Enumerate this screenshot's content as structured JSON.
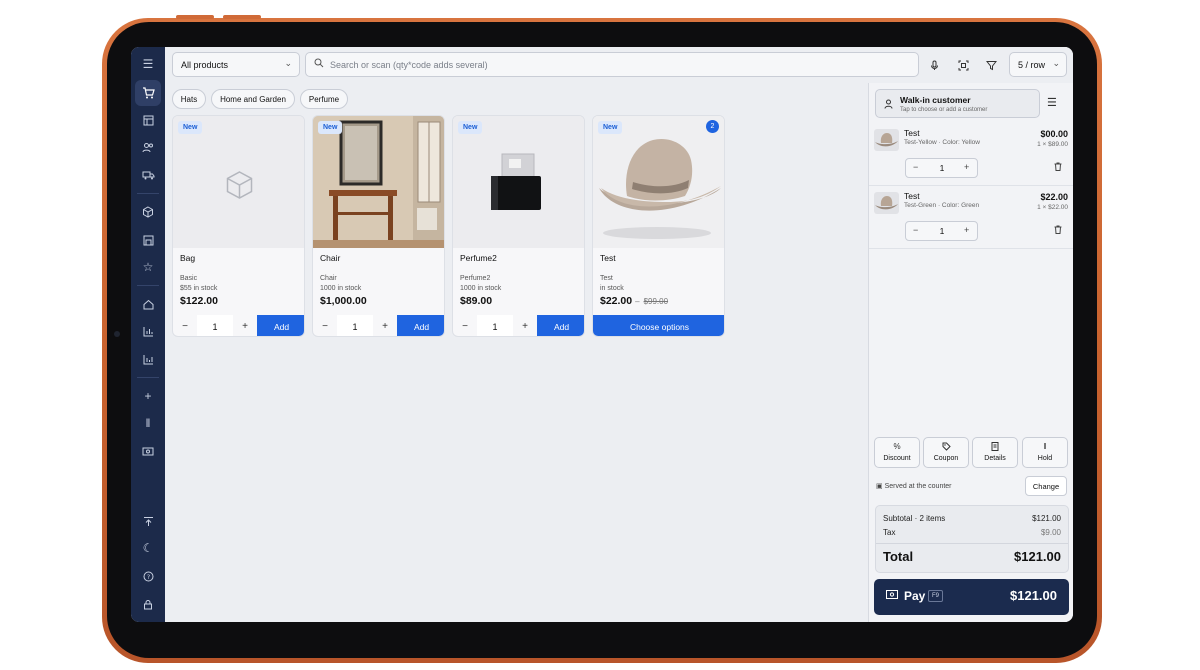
{
  "toolbar": {
    "category_select": "All products",
    "search_placeholder": "Search or scan (qty*code adds several)",
    "per_row": "5 / row"
  },
  "categories": [
    "Hats",
    "Home and Garden",
    "Perfume"
  ],
  "products": [
    {
      "badge": "New",
      "name": "Bag",
      "sku": "Basic",
      "stock": "$55 in stock",
      "price": "$122.00",
      "qty": "1",
      "add_label": "Add"
    },
    {
      "badge": "New",
      "name": "Chair",
      "sku": "Chair",
      "stock": "1000 in stock",
      "price": "$1,000.00",
      "qty": "1",
      "add_label": "Add"
    },
    {
      "badge": "New",
      "name": "Perfume2",
      "sku": "Perfume2",
      "stock": "1000 in stock",
      "price": "$89.00",
      "qty": "1",
      "add_label": "Add"
    },
    {
      "badge": "New",
      "count": "2",
      "name": "Test",
      "sku": "Test",
      "stock": "in stock",
      "price": "$22.00",
      "dash": "–",
      "old_price": "$99.00",
      "options_label": "Choose options"
    }
  ],
  "customer": {
    "title": "Walk-in customer",
    "subtitle": "Tap to choose or add a customer"
  },
  "cart": [
    {
      "name": "Test",
      "variant": "Test-Yellow · Color: Yellow",
      "total": "$00.00",
      "unit": "1 × $89.00",
      "qty": "1"
    },
    {
      "name": "Test",
      "variant": "Test-Green · Color: Green",
      "total": "$22.00",
      "unit": "1 × $22.00",
      "qty": "1"
    }
  ],
  "actions": [
    "Discount",
    "Coupon",
    "Details",
    "Hold"
  ],
  "service": {
    "label": "Served at the counter",
    "change_label": "Change"
  },
  "totals": {
    "subtotal_label": "Subtotal · 2 items",
    "subtotal": "$121.00",
    "tax_label": "Tax",
    "tax": "$9.00",
    "total_label": "Total",
    "total": "$121.00"
  },
  "pay": {
    "label": "Pay",
    "shortcut": "F9",
    "amount": "$121.00"
  },
  "colors": {
    "sidebar": "#1c2a4a",
    "accent": "#1f64e0",
    "pay_button": "#1b2b4e",
    "frame": "#c9632f"
  }
}
